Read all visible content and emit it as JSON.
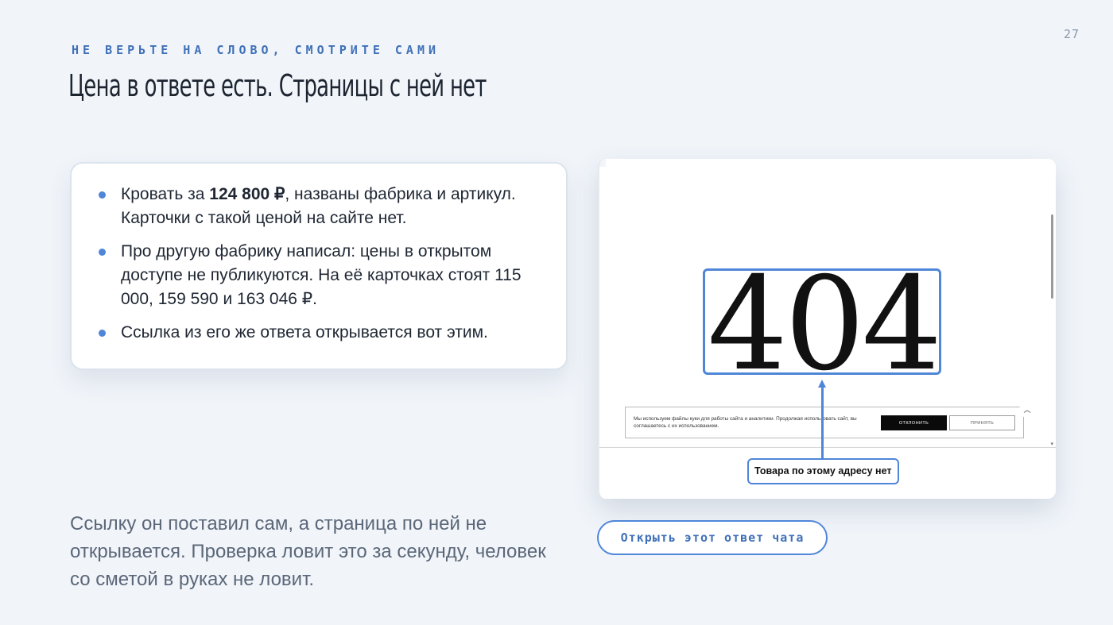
{
  "slide": {
    "page_number": "27",
    "eyebrow": "НЕ ВЕРЬТЕ НА СЛОВО, СМОТРИТЕ САМИ",
    "title": "Цена в ответе есть. Страницы с ней нет"
  },
  "card": {
    "bullets": [
      {
        "before": "Кровать за ",
        "bold": "124 800 ₽",
        "after": ", названы фабрика и артикул. Карточки с такой ценой на сайте нет."
      },
      {
        "text": "Про другую фабрику написал: цены в открытом доступе не публикуются. На её карточках стоят 115 000, 159 590 и 163 046 ₽."
      },
      {
        "text": "Ссылка из его же ответа открывается вот этим."
      }
    ]
  },
  "bottom_text": "Ссылку он поставил сам, а страница по ней не открывается. Проверка ловит это за секунду, человек со сметой в руках не ловит.",
  "screenshot": {
    "error_code": "404",
    "cookie_banner": {
      "text": "Мы используем файлы куки для работы сайта и аналитики. Продолжая использовать сайт, вы соглашаетесь с их использованием.",
      "decline_label": "ОТКЛОНИТЬ",
      "accept_label": "ПРИНЯТЬ",
      "collapse_icon": "chevron-up-icon"
    },
    "callout": "Товара по этому адресу нет"
  },
  "open_chat_button": "Открыть этот ответ чата",
  "colors": {
    "background": "#f1f5fa",
    "accent": "#4f86d8",
    "eyebrow": "#3f70b8",
    "title": "#1c2430",
    "muted_text": "#5b6778"
  }
}
